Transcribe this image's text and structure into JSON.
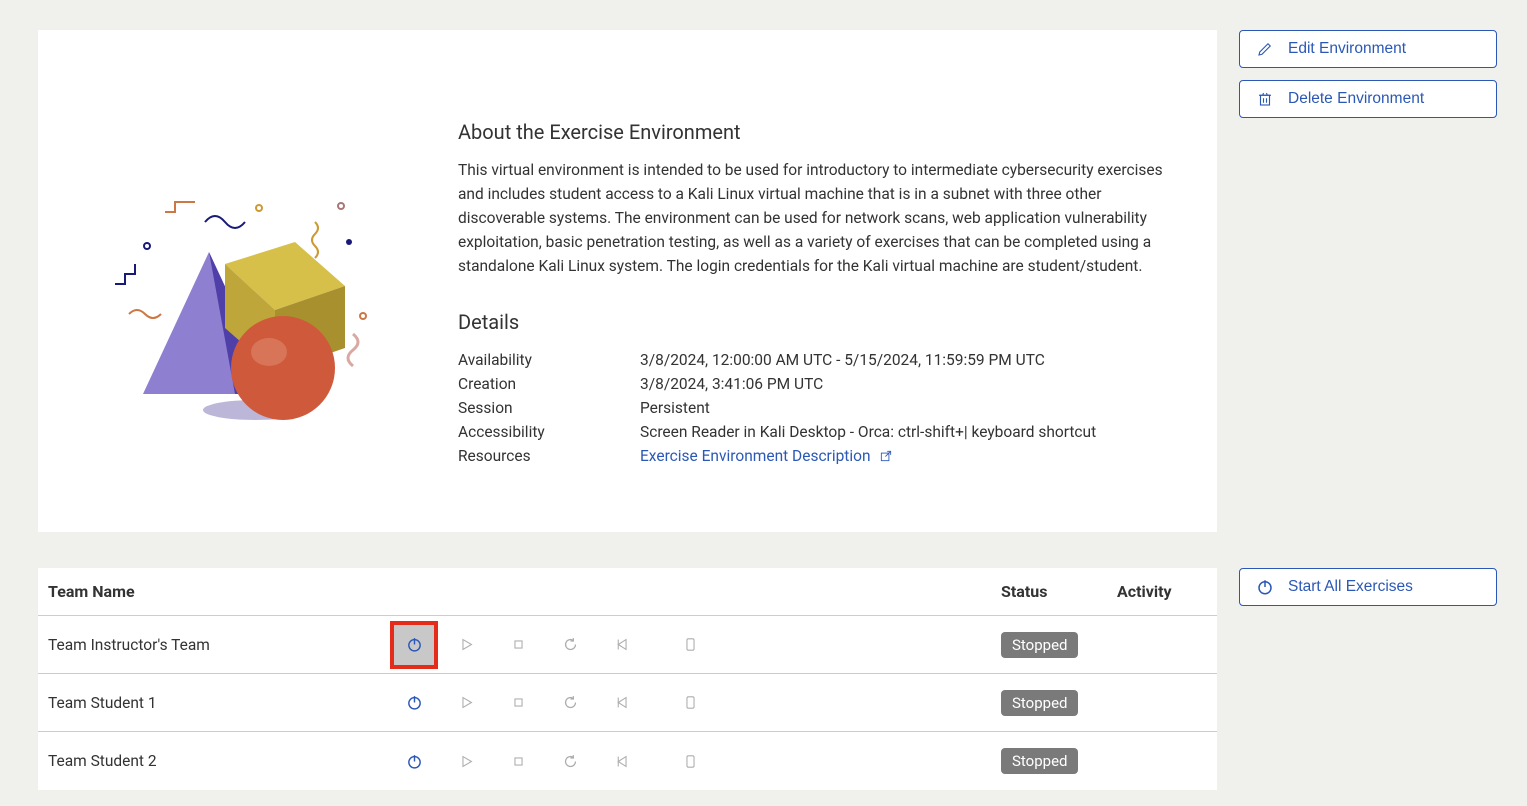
{
  "about": {
    "heading": "About the Exercise Environment",
    "description": "This virtual environment is intended to be used for introductory to intermediate cybersecurity exercises and includes student access to a Kali Linux virtual machine that is in a subnet with three other discoverable systems. The environment can be used for network scans, web application vulnerability exploitation, basic penetration testing, as well as a variety of exercises that can be completed using a standalone Kali Linux system. The login credentials for the Kali virtual machine are student/student."
  },
  "details": {
    "heading": "Details",
    "labels": {
      "availability": "Availability",
      "creation": "Creation",
      "session": "Session",
      "accessibility": "Accessibility",
      "resources": "Resources"
    },
    "values": {
      "availability": "3/8/2024, 12:00:00 AM UTC - 5/15/2024, 11:59:59 PM UTC",
      "creation": "3/8/2024, 3:41:06 PM UTC",
      "session": "Persistent",
      "accessibility": "Screen Reader in Kali Desktop - Orca: ctrl-shift+| keyboard shortcut",
      "resources_link": "Exercise Environment Description"
    }
  },
  "side": {
    "edit": "Edit Environment",
    "delete": "Delete Environment",
    "start_all": "Start All Exercises"
  },
  "teams": {
    "headers": {
      "name": "Team Name",
      "status": "Status",
      "activity": "Activity"
    },
    "rows": [
      {
        "name": "Team Instructor's Team",
        "status": "Stopped",
        "highlight_power": true
      },
      {
        "name": "Team Student 1",
        "status": "Stopped",
        "highlight_power": false
      },
      {
        "name": "Team Student 2",
        "status": "Stopped",
        "highlight_power": false
      }
    ]
  }
}
